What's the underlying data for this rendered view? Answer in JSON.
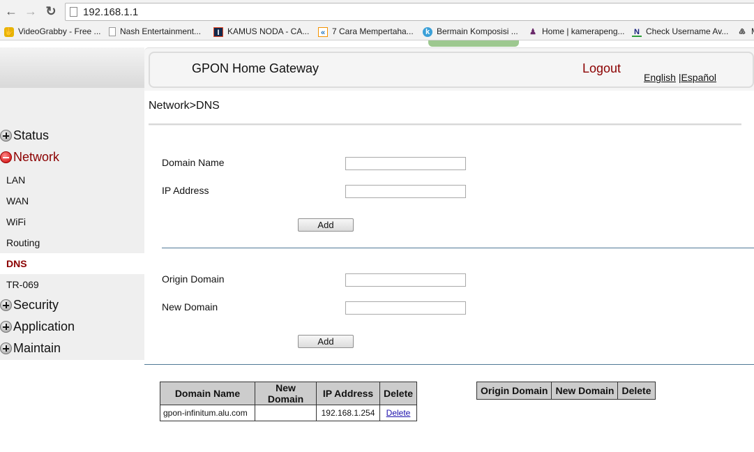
{
  "browser": {
    "url": "192.168.1.1",
    "bookmarks": [
      {
        "label": "VideoGrabby - Free ...",
        "icon": "hand-icon",
        "color": "#e8b400"
      },
      {
        "label": "Nash Entertainment...",
        "icon": "page-icon",
        "color": "#888888"
      },
      {
        "label": "KAMUS NODA - CA...",
        "icon": "illinois-logo-icon",
        "color": "#13294b"
      },
      {
        "label": "7 Cara Mempertaha...",
        "icon": "k-logo-icon",
        "color": "#f39200"
      },
      {
        "label": "Bermain Komposisi ...",
        "icon": "k-bubble-icon",
        "color": "#3ba0d8"
      },
      {
        "label": "Home | kamerapeng...",
        "icon": "spy-icon",
        "color": "#6b2a6b"
      },
      {
        "label": "Check Username Av...",
        "icon": "n-logo-icon",
        "color": "#1a237e"
      },
      {
        "label": "M",
        "icon": "figure-icon",
        "color": "#444444"
      }
    ]
  },
  "header": {
    "title": "GPON Home Gateway",
    "logout": "Logout",
    "lang_english": "English",
    "lang_sep": "|",
    "lang_spanish": "Español",
    "accent": "#8b0000"
  },
  "sidebar": {
    "groups": [
      {
        "label": "Status",
        "expanded": false
      },
      {
        "label": "Network",
        "expanded": true
      },
      {
        "label": "Security",
        "expanded": false
      },
      {
        "label": "Application",
        "expanded": false
      },
      {
        "label": "Maintain",
        "expanded": false
      }
    ],
    "network_items": [
      "LAN",
      "WAN",
      "WiFi",
      "Routing",
      "DNS",
      "TR-069"
    ],
    "active_item": "DNS"
  },
  "main": {
    "breadcrumb": "Network>DNS",
    "form1": {
      "domain_label": "Domain Name",
      "domain_value": "",
      "ip_label": "IP Address",
      "ip_value": "",
      "add_label": "Add"
    },
    "form2": {
      "origin_label": "Origin Domain",
      "origin_value": "",
      "new_label": "New Domain",
      "new_value": "",
      "add_label": "Add"
    },
    "table1": {
      "headers": [
        "Domain Name",
        "New Domain",
        "IP Address",
        "Delete"
      ],
      "rows": [
        {
          "domain": "gpon-infinitum.alu.com",
          "new_domain": "",
          "ip": "192.168.1.254",
          "action": "Delete"
        }
      ]
    },
    "table2": {
      "headers": [
        "Origin Domain",
        "New Domain",
        "Delete"
      ],
      "rows": []
    }
  }
}
